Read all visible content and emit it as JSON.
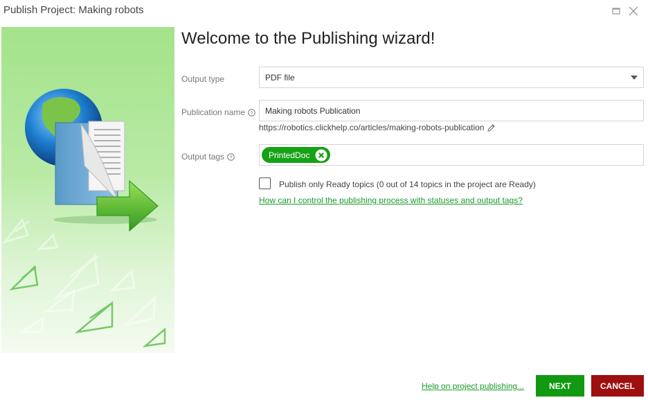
{
  "window": {
    "title": "Publish Project: Making robots"
  },
  "wizard": {
    "heading": "Welcome to the Publishing wizard!",
    "output_type": {
      "label": "Output type",
      "value": "PDF file"
    },
    "publication_name": {
      "label": "Publication name",
      "value": "Making robots Publication",
      "url": "https://robotics.clickhelp.co/articles/making-robots-publication"
    },
    "output_tags": {
      "label": "Output tags",
      "tags": [
        "PrintedDoc"
      ]
    },
    "ready_only": {
      "checked": false,
      "label": "Publish only Ready topics (0 out of 14 topics in the project are Ready)"
    },
    "status_help_link": "How can I control the publishing process with statuses and output tags?"
  },
  "footer": {
    "help_link": "Help on project publishing...",
    "next_label": "NEXT",
    "cancel_label": "CANCEL"
  },
  "colors": {
    "accent_green": "#119a11",
    "cancel_red": "#9e0f0f",
    "link_green": "#1a9b2a"
  },
  "icons": {
    "maximize": "maximize-icon",
    "close": "close-icon",
    "help": "question-circle-icon",
    "edit": "pencil-icon",
    "tag_remove": "x-circle-icon",
    "dropdown": "caret-down-icon"
  }
}
